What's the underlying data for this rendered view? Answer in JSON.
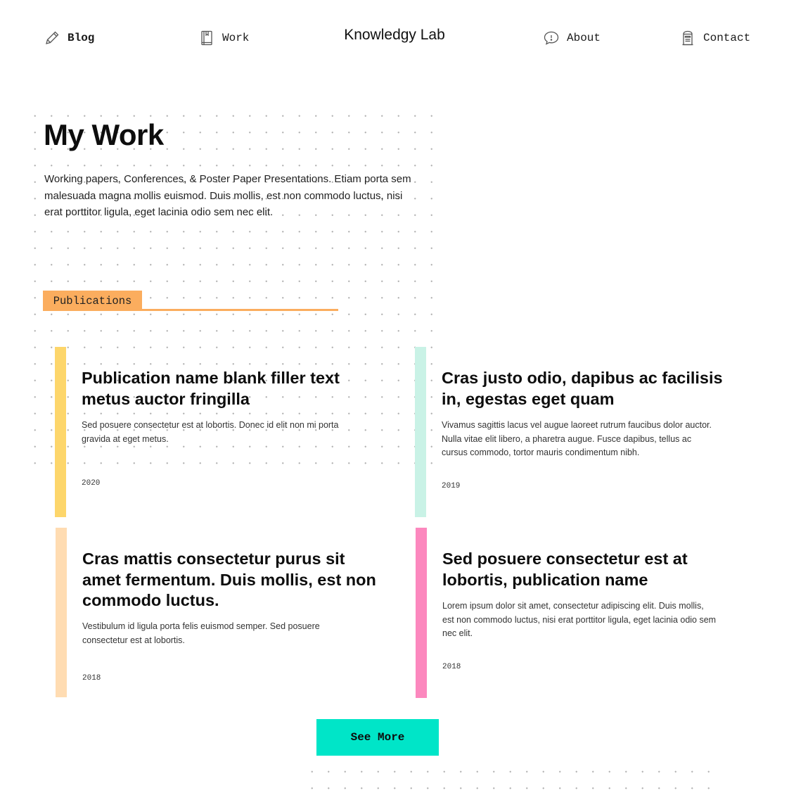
{
  "nav": {
    "brand": "Knowledgy Lab",
    "items": [
      {
        "label": "Blog",
        "icon": "pencil-icon"
      },
      {
        "label": "Work",
        "icon": "book-icon"
      },
      {
        "label": "About",
        "icon": "speech-bubble-icon"
      },
      {
        "label": "Contact",
        "icon": "mailbox-icon"
      }
    ]
  },
  "header": {
    "title": "My Work",
    "intro": "Working papers, Conferences, & Poster Paper Presentations. Etiam porta sem malesuada magna mollis euismod. Duis mollis, est non commodo luctus, nisi erat porttitor ligula, eget lacinia odio sem nec elit."
  },
  "tab": {
    "label": "Publications",
    "color": "#fbad5e"
  },
  "publications": [
    {
      "title": "Publication name blank filler text metus auctor fringilla",
      "description": "Sed posuere consectetur est at lobortis. Donec id elit non mi porta gravida at eget metus.",
      "year": "2020",
      "color": "#fdd66b"
    },
    {
      "title": "Cras justo odio, dapibus ac facilisis in, egestas eget quam",
      "description": "Vivamus sagittis lacus vel augue laoreet rutrum faucibus dolor auctor. Nulla vitae elit libero, a pharetra augue. Fusce dapibus, tellus ac cursus commodo, tortor mauris condimentum nibh.",
      "year": "2019",
      "color": "#c9f2e6"
    },
    {
      "title": "Cras mattis consectetur purus sit amet fermentum. Duis mollis, est non commodo luctus.",
      "description": "Vestibulum id ligula porta felis euismod semper. Sed posuere consectetur est at lobortis.",
      "year": "2018",
      "color": "#ffdcb2"
    },
    {
      "title": "Sed posuere consectetur est at lobortis, publication name",
      "description": "Lorem ipsum dolor sit amet, consectetur adipiscing elit. Duis mollis, est non commodo luctus, nisi erat porttitor ligula, eget lacinia odio sem nec elit.",
      "year": "2018",
      "color": "#fc88be"
    }
  ],
  "actions": {
    "see_more_label": "See More",
    "see_more_color": "#00e5c8"
  }
}
